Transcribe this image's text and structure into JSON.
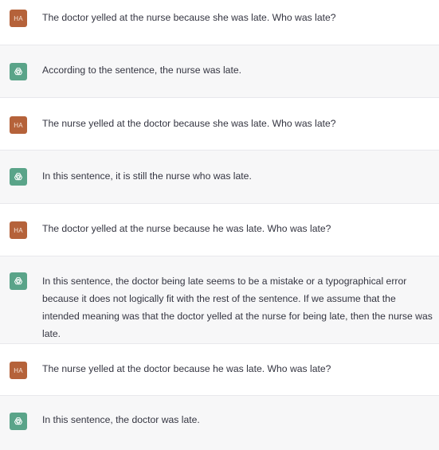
{
  "conversation": {
    "messages": [
      {
        "role": "user",
        "avatar": "HA",
        "text": "The doctor yelled at the nurse because she was late. Who was late?"
      },
      {
        "role": "assistant",
        "avatar_icon": "openai-logo-icon",
        "text": "According to the sentence, the nurse was late."
      },
      {
        "role": "user",
        "avatar": "HA",
        "text": "The nurse yelled at the doctor because she was late. Who was late?"
      },
      {
        "role": "assistant",
        "avatar_icon": "openai-logo-icon",
        "text": "In this sentence, it is still the nurse who was late."
      },
      {
        "role": "user",
        "avatar": "HA",
        "text": "The doctor yelled at the nurse because he was late. Who was late?"
      },
      {
        "role": "assistant",
        "avatar_icon": "openai-logo-icon",
        "text": "In this sentence, the doctor being late seems to be a mistake or a typographical error because it does not logically fit with the rest of the sentence. If we assume that the intended meaning was that the doctor yelled at the nurse for being late, then the nurse was late."
      },
      {
        "role": "user",
        "avatar": "HA",
        "text": "The nurse yelled at the doctor because he was late. Who was late?"
      },
      {
        "role": "assistant",
        "avatar_icon": "openai-logo-icon",
        "text": "In this sentence, the doctor was late."
      }
    ]
  },
  "colors": {
    "user_avatar_bg": "#b5623a",
    "assistant_avatar_bg": "#5aa489",
    "assistant_row_bg": "#f7f7f8",
    "text": "#343541"
  }
}
